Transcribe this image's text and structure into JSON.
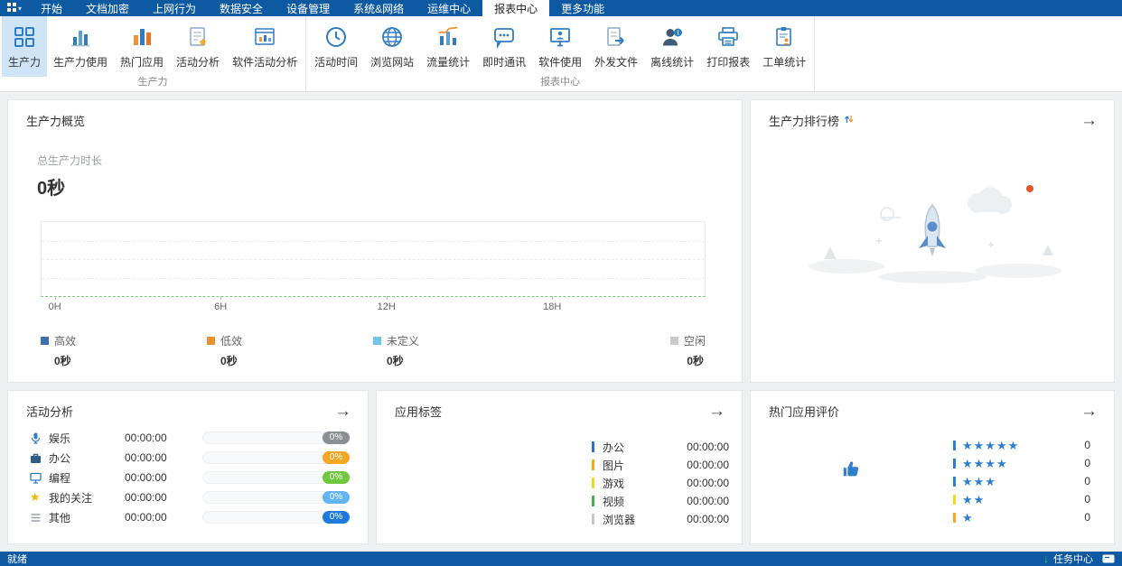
{
  "theme": {
    "titlebar": "#0e5aa2",
    "accent": "#2e7cc3",
    "active_tab_bg": "#ffffff",
    "selected_ribbon_bg": "#cfe4f6"
  },
  "menubar": {
    "tabs": [
      "开始",
      "文档加密",
      "上网行为",
      "数据安全",
      "设备管理",
      "系统&网络",
      "运维中心",
      "报表中心",
      "更多功能"
    ],
    "active_tab": "报表中心"
  },
  "ribbon": {
    "group1": {
      "label": "生产力",
      "items": [
        "生产力",
        "生产力使用",
        "热门应用",
        "活动分析",
        "软件活动分析"
      ],
      "selected_item": "生产力"
    },
    "group2": {
      "label": "报表中心",
      "items": [
        "活动时间",
        "浏览网站",
        "流量统计",
        "即时通讯",
        "软件使用",
        "外发文件",
        "离线统计",
        "打印报表",
        "工单统计"
      ]
    }
  },
  "overview": {
    "title": "生产力概览",
    "total_label": "总生产力时长",
    "total_value": "0秒",
    "chart_data": {
      "type": "area",
      "title": "生产力概览",
      "x_ticks": [
        "0H",
        "6H",
        "12H",
        "18H"
      ],
      "x_range": [
        "0H",
        "24H"
      ],
      "grid": "horizontal-dashed",
      "series": [
        {
          "name": "高效",
          "values": [],
          "total": "0秒",
          "color": "#3d6fb4"
        },
        {
          "name": "低效",
          "values": [],
          "total": "0秒",
          "color": "#e8912f"
        },
        {
          "name": "未定义",
          "values": [],
          "total": "0秒",
          "color": "#74c6e8"
        },
        {
          "name": "空闲",
          "values": [],
          "total": "0秒",
          "color": "#c9c9c9"
        }
      ]
    },
    "legend": [
      {
        "label": "高效",
        "value": "0秒",
        "color": "#3d6fb4"
      },
      {
        "label": "低效",
        "value": "0秒",
        "color": "#e8912f"
      },
      {
        "label": "未定义",
        "value": "0秒",
        "color": "#74c6e8"
      },
      {
        "label": "空闲",
        "value": "0秒",
        "color": "#c9c9c9"
      }
    ],
    "x_ticks": [
      "0H",
      "6H",
      "12H",
      "18H"
    ]
  },
  "ranking": {
    "title": "生产力排行榜"
  },
  "activity": {
    "title": "活动分析",
    "rows": [
      {
        "icon": "microphone-icon",
        "label": "娱乐",
        "time": "00:00:00",
        "percent": "0%",
        "color": "#8a8f94"
      },
      {
        "icon": "briefcase-icon",
        "label": "办公",
        "time": "00:00:00",
        "percent": "0%",
        "color": "#f5a623"
      },
      {
        "icon": "monitor-icon",
        "label": "编程",
        "time": "00:00:00",
        "percent": "0%",
        "color": "#6fc93e"
      },
      {
        "icon": "star-icon",
        "label": "我的关注",
        "time": "00:00:00",
        "percent": "0%",
        "color": "#64b5f6"
      },
      {
        "icon": "menu-icon",
        "label": "其他",
        "time": "00:00:00",
        "percent": "0%",
        "color": "#1f7ae0"
      }
    ]
  },
  "app_tags": {
    "title": "应用标签",
    "rows": [
      {
        "label": "办公",
        "time": "00:00:00",
        "color": "#2f6fd6"
      },
      {
        "label": "图片",
        "time": "00:00:00",
        "color": "#f5a623"
      },
      {
        "label": "游戏",
        "time": "00:00:00",
        "color": "#f0d928"
      },
      {
        "label": "视频",
        "time": "00:00:00",
        "color": "#4caf50"
      },
      {
        "label": "浏览器",
        "time": "00:00:00",
        "color": "#c5c9cc"
      }
    ]
  },
  "ratings": {
    "title": "热门应用评价",
    "star_color": "#2e7fd0",
    "rows": [
      {
        "stars": "★★★★★",
        "count": "0",
        "color": "#2e7fd0"
      },
      {
        "stars": "★★★★",
        "count": "0",
        "color": "#2e7fd0"
      },
      {
        "stars": "★★★",
        "count": "0",
        "color": "#2e7fd0"
      },
      {
        "stars": "★★",
        "count": "0",
        "color": "#f0d928"
      },
      {
        "stars": "★",
        "count": "0",
        "color": "#f5a623"
      }
    ]
  },
  "statusbar": {
    "left": "就绪",
    "task_center": "任务中心"
  }
}
